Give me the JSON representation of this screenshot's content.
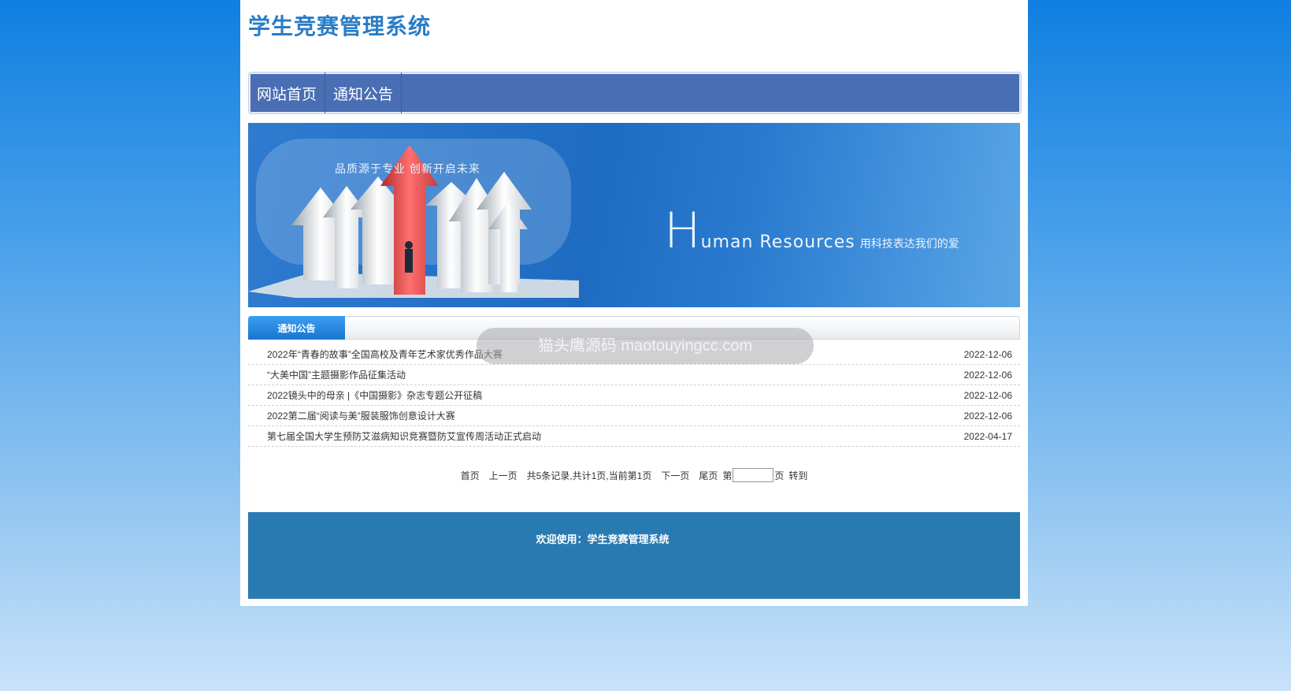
{
  "header": {
    "site_title": "学生竞赛管理系统"
  },
  "nav": {
    "items": [
      "网站首页",
      "通知公告"
    ]
  },
  "banner": {
    "slogan": "品质源于专业   创新开启未来",
    "hr_big": "H",
    "hr_rest": "uman Resources",
    "hr_cn": "用科技表达我们的爱"
  },
  "notices": {
    "tab_label": "通知公告",
    "items": [
      {
        "title": "2022年“青春的故事”全国高校及青年艺术家优秀作品大赛",
        "date": "2022-12-06"
      },
      {
        "title": "“大美中国”主题摄影作品征集活动",
        "date": "2022-12-06"
      },
      {
        "title": "2022镜头中的母亲 |《中国摄影》杂志专题公开征稿",
        "date": "2022-12-06"
      },
      {
        "title": "2022第二届“阅读与美”服装服饰创意设计大赛",
        "date": "2022-12-06"
      },
      {
        "title": "第七届全国大学生预防艾滋病知识竞赛暨防艾宣传周活动正式启动",
        "date": "2022-04-17"
      }
    ]
  },
  "pager": {
    "first": "首页",
    "prev": "上一页",
    "info": "共5条记录,共计1页,当前第1页",
    "next": "下一页",
    "last": "尾页",
    "page_prefix": "第",
    "page_suffix": "页",
    "goto": "转到",
    "page_value": ""
  },
  "footer": {
    "text": "欢迎使用：学生竞赛管理系统"
  },
  "watermark": {
    "text": "猫头鹰源码 maotouyingcc.com"
  },
  "colors": {
    "title_blue": "#2a7cc6",
    "nav_bg": "#4a6eb3",
    "footer_bg": "#2a7ab2",
    "tab_blue": "#1a74d2"
  }
}
